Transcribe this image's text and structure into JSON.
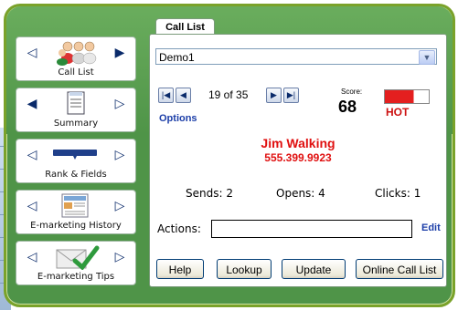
{
  "call_list_tab": "Call List",
  "list_select": {
    "value": "Demo1"
  },
  "record_nav": {
    "position": "19 of 35",
    "options_label": "Options"
  },
  "score": {
    "label": "Score:",
    "value": "68",
    "hot_label": "HOT",
    "level_fraction": 0.66,
    "bar_color": "#e41f1f"
  },
  "contact": {
    "name": "Jim Walking",
    "phone": "555.399.9923",
    "color": "#e01010"
  },
  "stats": {
    "sends": "Sends: 2",
    "opens": "Opens: 4",
    "clicks": "Clicks: 1"
  },
  "actions": {
    "label": "Actions:",
    "value": "",
    "edit_label": "Edit"
  },
  "buttons": {
    "help": "Help",
    "lookup": "Lookup",
    "update": "Update",
    "online": "Online Call List"
  },
  "sidebar": {
    "items": [
      {
        "label": "Call List",
        "icon": "people-icon"
      },
      {
        "label": "Summary",
        "icon": "document-icon"
      },
      {
        "label": "Rank & Fields",
        "icon": "rank-bar-icon"
      },
      {
        "label": "E-marketing History",
        "icon": "newsletter-icon"
      },
      {
        "label": "E-marketing Tips",
        "icon": "envelope-check-icon"
      }
    ]
  },
  "theme": {
    "frame_green": "#4f9448",
    "border_green": "#7aa22a",
    "link_blue": "#1c3ea8"
  }
}
